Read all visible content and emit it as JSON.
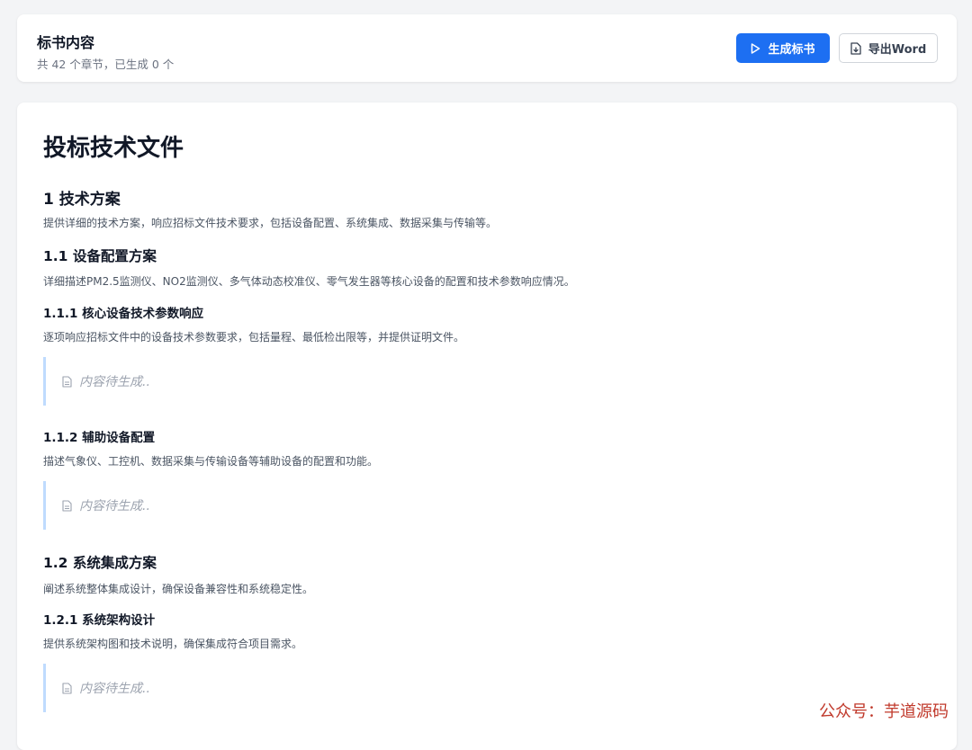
{
  "header": {
    "title": "标书内容",
    "subtitle": "共 42 个章节，已生成 0 个",
    "generate_label": "生成标书",
    "export_label": "导出Word"
  },
  "document": {
    "title": "投标技术文件",
    "placeholder_text": "内容待生成..",
    "sections": [
      {
        "heading": "1 技术方案",
        "desc": "提供详细的技术方案，响应招标文件技术要求，包括设备配置、系统集成、数据采集与传输等。"
      },
      {
        "heading": "1.1 设备配置方案",
        "desc": "详细描述PM2.5监测仪、NO2监测仪、多气体动态校准仪、零气发生器等核心设备的配置和技术参数响应情况。"
      },
      {
        "heading": "1.1.1 核心设备技术参数响应",
        "desc": "逐项响应招标文件中的设备技术参数要求，包括量程、最低检出限等，并提供证明文件。"
      },
      {
        "heading": "1.1.2 辅助设备配置",
        "desc": "描述气象仪、工控机、数据采集与传输设备等辅助设备的配置和功能。"
      },
      {
        "heading": "1.2 系统集成方案",
        "desc": "阐述系统整体集成设计，确保设备兼容性和系统稳定性。"
      },
      {
        "heading": "1.2.1 系统架构设计",
        "desc": "提供系统架构图和技术说明，确保集成符合项目需求。"
      }
    ]
  },
  "watermark": "公众号：芋道源码",
  "colors": {
    "primary": "#1d6ff2",
    "placeholder_border": "#bfdbfe"
  },
  "icons": {
    "generate": "play-icon",
    "export": "file-export-icon",
    "placeholder": "document-icon"
  }
}
